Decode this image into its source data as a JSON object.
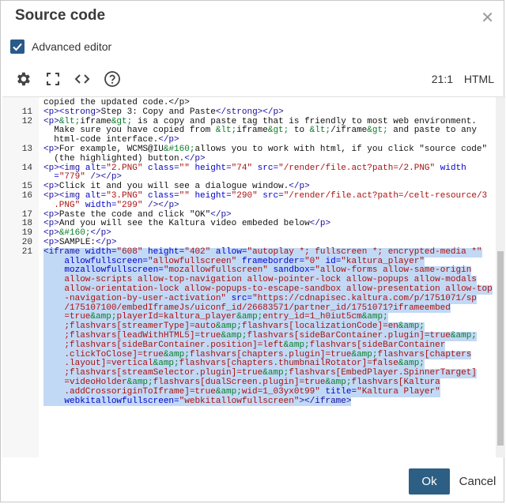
{
  "dialog": {
    "title": "Source code",
    "close_glyph": "✕",
    "advanced_editor_label": "Advanced editor",
    "advanced_editor_checked": true
  },
  "toolbar": {
    "icons": [
      "gear-icon",
      "fullscreen-icon",
      "code-icon",
      "help-icon"
    ],
    "cursor_position": "21:1",
    "mode": "HTML"
  },
  "editor": {
    "lines": [
      {
        "ln": "",
        "selected": false,
        "tokens": [
          [
            "plain",
            "copied the updated code.</p>"
          ]
        ]
      },
      {
        "ln": "11",
        "selected": false,
        "tokens": [
          [
            "tag",
            "<p><strong>"
          ],
          [
            "plain",
            "Step 3: Copy and Paste"
          ],
          [
            "tag",
            "</strong></p>"
          ]
        ]
      },
      {
        "ln": "12",
        "selected": false,
        "tokens": [
          [
            "tag",
            "<p>"
          ],
          [
            "ent",
            "&lt;"
          ],
          [
            "plain",
            "iframe"
          ],
          [
            "ent",
            "&gt;"
          ],
          [
            "plain",
            " is a copy and paste tag that is friendly to most web environment."
          ]
        ]
      },
      {
        "ln": "",
        "selected": false,
        "tokens": [
          [
            "plain",
            "  Make sure you have copied from "
          ],
          [
            "ent",
            "&lt;"
          ],
          [
            "plain",
            "iframe"
          ],
          [
            "ent",
            "&gt;"
          ],
          [
            "plain",
            " to "
          ],
          [
            "ent",
            "&lt;"
          ],
          [
            "plain",
            "/iframe"
          ],
          [
            "ent",
            "&gt;"
          ],
          [
            "plain",
            " and paste to any"
          ]
        ]
      },
      {
        "ln": "",
        "selected": false,
        "tokens": [
          [
            "plain",
            "  html-code interface."
          ],
          [
            "tag",
            "</p>"
          ]
        ]
      },
      {
        "ln": "13",
        "selected": false,
        "tokens": [
          [
            "tag",
            "<p>"
          ],
          [
            "plain",
            "For example, WCMS@IU"
          ],
          [
            "ent",
            "&#160;"
          ],
          [
            "plain",
            "allows you to work with html, if you click \"source code\""
          ]
        ]
      },
      {
        "ln": "",
        "selected": false,
        "tokens": [
          [
            "plain",
            "  (the highlighted) button."
          ],
          [
            "tag",
            "</p>"
          ]
        ]
      },
      {
        "ln": "14",
        "selected": false,
        "tokens": [
          [
            "tag",
            "<p><img "
          ],
          [
            "attr",
            "alt="
          ],
          [
            "str",
            "\"2.PNG\""
          ],
          [
            "attr",
            " class="
          ],
          [
            "str",
            "\"\""
          ],
          [
            "attr",
            " height="
          ],
          [
            "str",
            "\"74\""
          ],
          [
            "attr",
            " src="
          ],
          [
            "str",
            "\"/render/file.act?path=/2.PNG\""
          ],
          [
            "attr",
            " width"
          ]
        ]
      },
      {
        "ln": "",
        "selected": false,
        "tokens": [
          [
            "attr",
            "  ="
          ],
          [
            "str",
            "\"779\""
          ],
          [
            "tag",
            " /></p>"
          ]
        ]
      },
      {
        "ln": "15",
        "selected": false,
        "tokens": [
          [
            "tag",
            "<p>"
          ],
          [
            "plain",
            "Click it and you will see a dialogue window."
          ],
          [
            "tag",
            "</p>"
          ]
        ]
      },
      {
        "ln": "16",
        "selected": false,
        "tokens": [
          [
            "tag",
            "<p><img "
          ],
          [
            "attr",
            "alt="
          ],
          [
            "str",
            "\"3.PNG\""
          ],
          [
            "attr",
            " class="
          ],
          [
            "str",
            "\"\""
          ],
          [
            "attr",
            " height="
          ],
          [
            "str",
            "\"290\""
          ],
          [
            "attr",
            " src="
          ],
          [
            "str",
            "\"/render/file.act?path=/celt-resource/3"
          ]
        ]
      },
      {
        "ln": "",
        "selected": false,
        "tokens": [
          [
            "str",
            "  .PNG\""
          ],
          [
            "attr",
            " width="
          ],
          [
            "str",
            "\"299\""
          ],
          [
            "tag",
            " /></p>"
          ]
        ]
      },
      {
        "ln": "17",
        "selected": false,
        "tokens": [
          [
            "tag",
            "<p>"
          ],
          [
            "plain",
            "Paste the code and click \"OK\""
          ],
          [
            "tag",
            "</p>"
          ]
        ]
      },
      {
        "ln": "18",
        "selected": false,
        "tokens": [
          [
            "tag",
            "<p>"
          ],
          [
            "plain",
            "And you will see the Kaltura video embeded below"
          ],
          [
            "tag",
            "</p>"
          ]
        ]
      },
      {
        "ln": "19",
        "selected": false,
        "tokens": [
          [
            "tag",
            "<p>"
          ],
          [
            "ent",
            "&#160;"
          ],
          [
            "tag",
            "</p>"
          ]
        ]
      },
      {
        "ln": "20",
        "selected": false,
        "tokens": [
          [
            "tag",
            "<p>"
          ],
          [
            "plain",
            "SAMPLE:"
          ],
          [
            "tag",
            "</p>"
          ]
        ]
      },
      {
        "ln": "21",
        "selected": true,
        "tokens": [
          [
            "tag",
            "<iframe "
          ],
          [
            "attr",
            "width="
          ],
          [
            "str",
            "\"608\""
          ],
          [
            "attr",
            " height="
          ],
          [
            "str",
            "\"402\""
          ],
          [
            "attr",
            " allow="
          ],
          [
            "str",
            "\"autoplay *; fullscreen *; encrypted-media *\""
          ]
        ]
      },
      {
        "ln": "",
        "selected": true,
        "tokens": [
          [
            "attr",
            "    allowfullscreen="
          ],
          [
            "str",
            "\"allowfullscreen\""
          ],
          [
            "attr",
            " frameborder="
          ],
          [
            "str",
            "\"0\""
          ],
          [
            "attr",
            " id="
          ],
          [
            "str",
            "\"kaltura_player\""
          ]
        ]
      },
      {
        "ln": "",
        "selected": true,
        "tokens": [
          [
            "attr",
            "    mozallowfullscreen="
          ],
          [
            "str",
            "\"mozallowfullscreen\""
          ],
          [
            "attr",
            " sandbox="
          ],
          [
            "str",
            "\"allow-forms allow-same-origin"
          ]
        ]
      },
      {
        "ln": "",
        "selected": true,
        "tokens": [
          [
            "str",
            "    allow-scripts allow-top-navigation allow-pointer-lock allow-popups allow-modals"
          ]
        ]
      },
      {
        "ln": "",
        "selected": true,
        "tokens": [
          [
            "str",
            "    allow-orientation-lock allow-popups-to-escape-sandbox allow-presentation allow-top"
          ]
        ]
      },
      {
        "ln": "",
        "selected": true,
        "tokens": [
          [
            "str",
            "    -navigation-by-user-activation\""
          ],
          [
            "attr",
            " src="
          ],
          [
            "str",
            "\"https://cdnapisec.kaltura.com/p/1751071/sp"
          ]
        ]
      },
      {
        "ln": "",
        "selected": true,
        "tokens": [
          [
            "str",
            "    /175107100/embedIframeJs/uiconf_id/26683571/partner_id/1751071?iframeembed"
          ]
        ]
      },
      {
        "ln": "",
        "selected": true,
        "tokens": [
          [
            "str",
            "    =true"
          ],
          [
            "ent",
            "&amp;"
          ],
          [
            "str",
            "playerId=kaltura_player"
          ],
          [
            "ent",
            "&amp;"
          ],
          [
            "str",
            "entry_id=1_h0iut5cm"
          ],
          [
            "ent",
            "&amp;"
          ]
        ]
      },
      {
        "ln": "",
        "selected": true,
        "tokens": [
          [
            "str",
            "    ;flashvars[streamerType]=auto"
          ],
          [
            "ent",
            "&amp;"
          ],
          [
            "str",
            "flashvars[localizationCode]=en"
          ],
          [
            "ent",
            "&amp;"
          ]
        ]
      },
      {
        "ln": "",
        "selected": true,
        "tokens": [
          [
            "str",
            "    ;flashvars[leadWithHTML5]=true"
          ],
          [
            "ent",
            "&amp;"
          ],
          [
            "str",
            "flashvars[sideBarContainer.plugin]=true"
          ],
          [
            "ent",
            "&amp;"
          ]
        ]
      },
      {
        "ln": "",
        "selected": true,
        "tokens": [
          [
            "str",
            "    ;flashvars[sideBarContainer.position]=left"
          ],
          [
            "ent",
            "&amp;"
          ],
          [
            "str",
            "flashvars[sideBarContainer"
          ]
        ]
      },
      {
        "ln": "",
        "selected": true,
        "tokens": [
          [
            "str",
            "    .clickToClose]=true"
          ],
          [
            "ent",
            "&amp;"
          ],
          [
            "str",
            "flashvars[chapters.plugin]=true"
          ],
          [
            "ent",
            "&amp;"
          ],
          [
            "str",
            "flashvars[chapters"
          ]
        ]
      },
      {
        "ln": "",
        "selected": true,
        "tokens": [
          [
            "str",
            "    .layout]=vertical"
          ],
          [
            "ent",
            "&amp;"
          ],
          [
            "str",
            "flashvars[chapters.thumbnailRotator]=false"
          ],
          [
            "ent",
            "&amp;"
          ]
        ]
      },
      {
        "ln": "",
        "selected": true,
        "tokens": [
          [
            "str",
            "    ;flashvars[streamSelector.plugin]=true"
          ],
          [
            "ent",
            "&amp;"
          ],
          [
            "str",
            "flashvars[EmbedPlayer.SpinnerTarget]"
          ]
        ]
      },
      {
        "ln": "",
        "selected": true,
        "tokens": [
          [
            "str",
            "    =videoHolder"
          ],
          [
            "ent",
            "&amp;"
          ],
          [
            "str",
            "flashvars[dualScreen.plugin]=true"
          ],
          [
            "ent",
            "&amp;"
          ],
          [
            "str",
            "flashvars[Kaltura"
          ]
        ]
      },
      {
        "ln": "",
        "selected": true,
        "tokens": [
          [
            "str",
            "    .addCrossoriginToIframe]=true"
          ],
          [
            "ent",
            "&amp;"
          ],
          [
            "str",
            "wid=1_03yx0t99\""
          ],
          [
            "attr",
            " title="
          ],
          [
            "str",
            "\"Kaltura Player\""
          ]
        ]
      },
      {
        "ln": "",
        "selected": true,
        "tokens": [
          [
            "attr",
            "    webkitallowfullscreen="
          ],
          [
            "str",
            "\"webkitallowfullscreen\""
          ],
          [
            "tag",
            "></iframe>"
          ]
        ]
      }
    ]
  },
  "footer": {
    "ok_label": "Ok",
    "cancel_label": "Cancel"
  }
}
